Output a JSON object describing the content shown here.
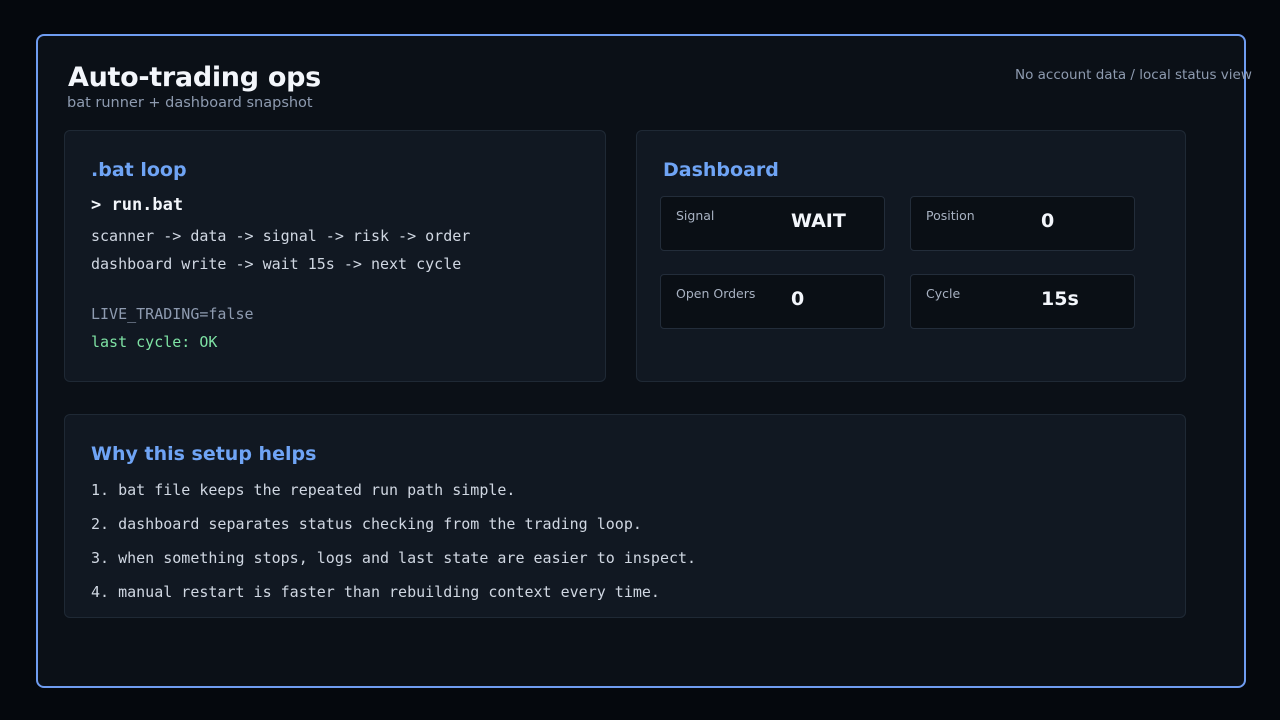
{
  "header": {
    "title": "Auto-trading ops",
    "subtitle": "bat runner + dashboard snapshot",
    "status_note": "No account data / local status view"
  },
  "bat_panel": {
    "title": ".bat loop",
    "command": "> run.bat",
    "flow_line_1": "scanner -> data -> signal -> risk -> order",
    "flow_line_2": "dashboard write -> wait 15s -> next cycle",
    "live_trading": "LIVE_TRADING=false",
    "last_cycle": "last cycle: OK"
  },
  "dashboard": {
    "title": "Dashboard",
    "stats": [
      {
        "label": "Signal",
        "value": "WAIT"
      },
      {
        "label": "Position",
        "value": "0"
      },
      {
        "label": "Open Orders",
        "value": "0"
      },
      {
        "label": "Cycle",
        "value": "15s"
      }
    ]
  },
  "why_panel": {
    "title": "Why this setup helps",
    "reasons": [
      "1. bat file keeps the repeated run path simple.",
      "2. dashboard separates status checking from the trading loop.",
      "3. when something stops, logs and last state are easier to inspect.",
      "4. manual restart is faster than rebuilding context every time."
    ]
  },
  "colors": {
    "accent": "#6fa4f5",
    "frame_border": "#6f9cf0",
    "ok_green": "#7ee2a4",
    "background": "#05080d"
  }
}
